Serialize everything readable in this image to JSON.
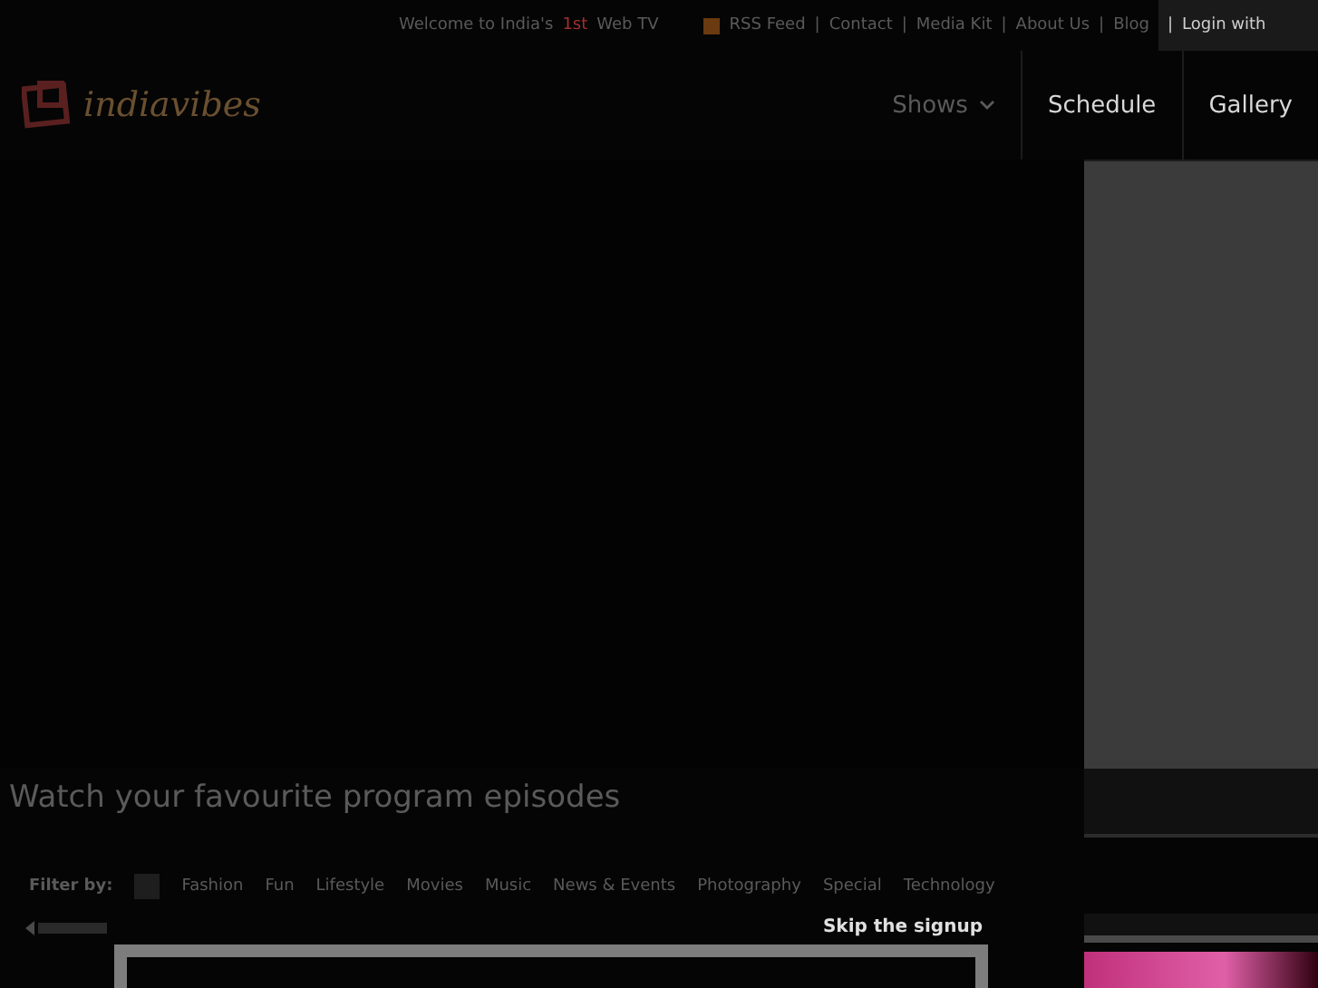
{
  "top_bar": {
    "welcome": "Welcome to India's",
    "highlight": "1st",
    "welcome_end": "Web TV",
    "links": [
      "RSS Feed",
      "Contact",
      "Media Kit",
      "About Us",
      "Blog"
    ],
    "separator": "|",
    "login": "Login with"
  },
  "logo": {
    "text": "indiavibes"
  },
  "nav": [
    {
      "label": "Shows",
      "kind": "dropdown",
      "dimmed": true
    },
    {
      "label": "Schedule",
      "kind": "link",
      "dimmed": false
    },
    {
      "label": "Gallery",
      "kind": "link",
      "dimmed": false
    }
  ],
  "heading": "Watch your favourite program episodes",
  "filter": {
    "label": "Filter by:",
    "options": [
      {
        "selected": true
      },
      {
        "label": "Fashion",
        "selected": false
      },
      {
        "label": "Fun",
        "selected": false
      },
      {
        "label": "Lifestyle",
        "selected": false
      },
      {
        "label": "Movies",
        "selected": false
      },
      {
        "label": "Music",
        "selected": false
      },
      {
        "label": "News & Events",
        "selected": false
      },
      {
        "label": "Photography",
        "selected": false
      },
      {
        "label": "Special",
        "selected": false
      },
      {
        "label": "Technology",
        "selected": false
      }
    ]
  },
  "signup": {
    "skip": "Skip the signup"
  }
}
